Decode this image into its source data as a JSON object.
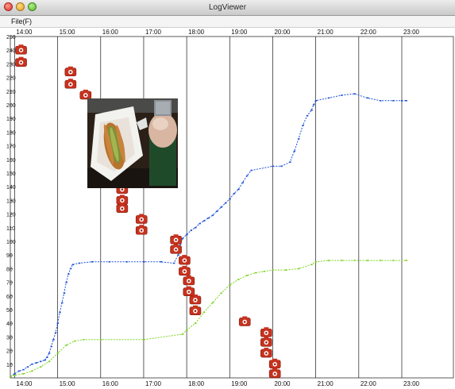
{
  "window": {
    "title": "LogViewer"
  },
  "menu": {
    "file_label": "File(F)"
  },
  "icons": {
    "marker": "camera-icon",
    "photo": "food-photo"
  },
  "colors": {
    "blue_series": "#1f52d8",
    "green_series": "#7ed321",
    "marker_fill": "#c8321e",
    "grid": "#1a1a1a"
  },
  "chart_data": {
    "type": "scatter",
    "x_ticks": [
      "14:00",
      "15:00",
      "16:00",
      "17:00",
      "18:00",
      "19:00",
      "20:00",
      "21:00",
      "22:00",
      "23:00"
    ],
    "y_ticks": [
      10,
      20,
      30,
      40,
      50,
      60,
      70,
      80,
      90,
      100,
      110,
      120,
      130,
      140,
      150,
      160,
      170,
      180,
      190,
      200,
      210,
      220,
      230,
      240,
      250
    ],
    "xlim": [
      13.9,
      24.2
    ],
    "ylim": [
      0,
      250
    ],
    "grid": "vertical",
    "series": [
      {
        "color": "blue",
        "points": [
          [
            13.9,
            1
          ],
          [
            14.0,
            3
          ],
          [
            14.1,
            5
          ],
          [
            14.2,
            6
          ],
          [
            14.3,
            8
          ],
          [
            14.4,
            10
          ],
          [
            14.5,
            11
          ],
          [
            14.6,
            12
          ],
          [
            14.7,
            13
          ],
          [
            14.75,
            15
          ],
          [
            14.8,
            18
          ],
          [
            14.85,
            23
          ],
          [
            14.9,
            28
          ],
          [
            14.95,
            33
          ],
          [
            15.0,
            40
          ],
          [
            15.05,
            48
          ],
          [
            15.1,
            55
          ],
          [
            15.15,
            62
          ],
          [
            15.2,
            70
          ],
          [
            15.25,
            76
          ],
          [
            15.3,
            80
          ],
          [
            15.35,
            83
          ],
          [
            15.5,
            84
          ],
          [
            15.8,
            85
          ],
          [
            16.2,
            85
          ],
          [
            16.6,
            85
          ],
          [
            17.0,
            85
          ],
          [
            17.4,
            85
          ],
          [
            17.7,
            84
          ],
          [
            17.8,
            90
          ],
          [
            17.85,
            98
          ],
          [
            17.9,
            102
          ],
          [
            18.0,
            105
          ],
          [
            18.1,
            108
          ],
          [
            18.2,
            110
          ],
          [
            18.3,
            113
          ],
          [
            18.4,
            115
          ],
          [
            18.5,
            117
          ],
          [
            18.6,
            119
          ],
          [
            18.7,
            122
          ],
          [
            18.8,
            125
          ],
          [
            18.9,
            128
          ],
          [
            19.0,
            131
          ],
          [
            19.1,
            135
          ],
          [
            19.2,
            138
          ],
          [
            19.3,
            143
          ],
          [
            19.4,
            148
          ],
          [
            19.5,
            152
          ],
          [
            20.0,
            155
          ],
          [
            20.2,
            155
          ],
          [
            20.4,
            158
          ],
          [
            20.5,
            166
          ],
          [
            20.6,
            175
          ],
          [
            20.7,
            185
          ],
          [
            20.8,
            192
          ],
          [
            20.9,
            196
          ],
          [
            20.95,
            200
          ],
          [
            21.0,
            203
          ],
          [
            21.3,
            205
          ],
          [
            21.6,
            207
          ],
          [
            21.9,
            208
          ],
          [
            22.2,
            205
          ],
          [
            22.5,
            203
          ],
          [
            22.8,
            203
          ],
          [
            23.0,
            203
          ],
          [
            23.1,
            203
          ]
        ]
      },
      {
        "color": "green",
        "points": [
          [
            13.9,
            1
          ],
          [
            14.0,
            2
          ],
          [
            14.2,
            3
          ],
          [
            14.4,
            5
          ],
          [
            14.6,
            8
          ],
          [
            14.8,
            12
          ],
          [
            15.0,
            18
          ],
          [
            15.2,
            24
          ],
          [
            15.4,
            27
          ],
          [
            15.6,
            28
          ],
          [
            16.0,
            28
          ],
          [
            17.0,
            28
          ],
          [
            17.9,
            32
          ],
          [
            18.0,
            35
          ],
          [
            18.2,
            40
          ],
          [
            18.4,
            48
          ],
          [
            18.6,
            55
          ],
          [
            18.8,
            62
          ],
          [
            19.0,
            68
          ],
          [
            19.2,
            72
          ],
          [
            19.4,
            75
          ],
          [
            19.6,
            77
          ],
          [
            19.8,
            78
          ],
          [
            20.0,
            79
          ],
          [
            20.3,
            79
          ],
          [
            20.6,
            80
          ],
          [
            20.9,
            83
          ],
          [
            21.0,
            85
          ],
          [
            21.3,
            86
          ],
          [
            21.6,
            86
          ],
          [
            21.9,
            86
          ],
          [
            22.2,
            86
          ],
          [
            22.5,
            86
          ],
          [
            22.8,
            86
          ],
          [
            23.1,
            86
          ]
        ]
      },
      {
        "color": "marker",
        "points": [
          [
            14.15,
            240
          ],
          [
            14.15,
            231
          ],
          [
            15.3,
            224
          ],
          [
            15.3,
            215
          ],
          [
            15.65,
            207
          ],
          [
            16.5,
            138
          ],
          [
            16.5,
            130
          ],
          [
            16.5,
            124
          ],
          [
            16.95,
            116
          ],
          [
            16.95,
            108
          ],
          [
            17.75,
            101
          ],
          [
            17.75,
            94
          ],
          [
            17.95,
            86
          ],
          [
            17.95,
            78
          ],
          [
            18.05,
            71
          ],
          [
            18.05,
            63
          ],
          [
            18.2,
            57
          ],
          [
            18.2,
            49
          ],
          [
            19.35,
            41
          ],
          [
            19.85,
            33
          ],
          [
            19.85,
            26
          ],
          [
            19.85,
            18
          ],
          [
            20.05,
            10
          ],
          [
            20.05,
            3
          ]
        ]
      }
    ]
  }
}
